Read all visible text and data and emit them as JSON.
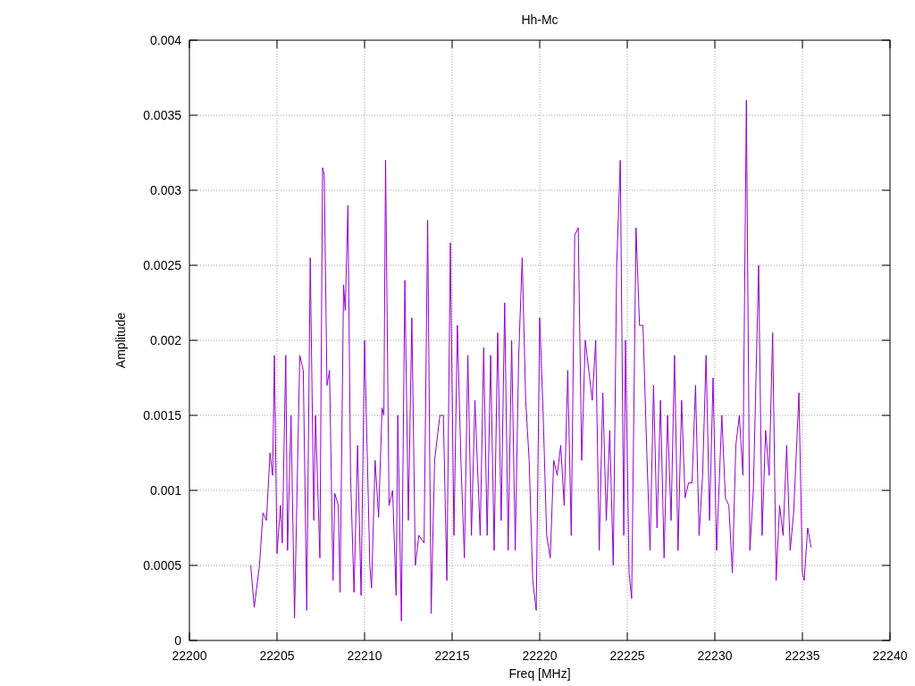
{
  "chart_data": {
    "type": "line",
    "grid": true,
    "title": "Hh-Mc",
    "xlabel": "Freq [MHz]",
    "ylabel": "Amplitude",
    "xlim": [
      22200,
      22240
    ],
    "ylim": [
      0,
      0.004
    ],
    "xticks": [
      {
        "value": 22200,
        "label": "22200"
      },
      {
        "value": 22205,
        "label": "22205"
      },
      {
        "value": 22210,
        "label": "22210"
      },
      {
        "value": 22215,
        "label": "22215"
      },
      {
        "value": 22220,
        "label": "22220"
      },
      {
        "value": 22225,
        "label": "22225"
      },
      {
        "value": 22230,
        "label": "22230"
      },
      {
        "value": 22235,
        "label": "22235"
      },
      {
        "value": 22240,
        "label": "22240"
      }
    ],
    "yticks": [
      {
        "value": 0,
        "label": "0"
      },
      {
        "value": 0.0005,
        "label": "0.0005"
      },
      {
        "value": 0.001,
        "label": "0.001"
      },
      {
        "value": 0.0015,
        "label": "0.0015"
      },
      {
        "value": 0.002,
        "label": "0.002"
      },
      {
        "value": 0.0025,
        "label": "0.0025"
      },
      {
        "value": 0.003,
        "label": "0.003"
      },
      {
        "value": 0.0035,
        "label": "0.0035"
      },
      {
        "value": 0.004,
        "label": "0.004"
      }
    ],
    "x": [
      22203.5,
      22203.7,
      22204.0,
      22204.2,
      22204.4,
      22204.6,
      22204.75,
      22204.85,
      22205.0,
      22205.2,
      22205.3,
      22205.5,
      22205.6,
      22205.8,
      22206.0,
      22206.3,
      22206.5,
      22206.7,
      22206.9,
      22207.1,
      22207.2,
      22207.45,
      22207.6,
      22207.7,
      22207.85,
      22208.0,
      22208.2,
      22208.3,
      22208.5,
      22208.6,
      22208.8,
      22208.9,
      22209.05,
      22209.2,
      22209.4,
      22209.6,
      22209.8,
      22210.0,
      22210.3,
      22210.4,
      22210.6,
      22210.8,
      22211.0,
      22211.1,
      22211.2,
      22211.4,
      22211.6,
      22211.8,
      22211.9,
      22212.1,
      22212.3,
      22212.5,
      22212.7,
      22212.9,
      22213.1,
      22213.4,
      22213.6,
      22213.8,
      22214.0,
      22214.3,
      22214.5,
      22214.7,
      22214.9,
      22215.1,
      22215.3,
      22215.5,
      22215.7,
      22215.9,
      22216.1,
      22216.3,
      22216.6,
      22216.8,
      22217.0,
      22217.2,
      22217.4,
      22217.6,
      22217.8,
      22218.0,
      22218.2,
      22218.4,
      22218.6,
      22218.8,
      22219.0,
      22219.2,
      22219.4,
      22219.6,
      22219.8,
      22220.0,
      22220.2,
      22220.4,
      22220.6,
      22220.8,
      22221.0,
      22221.2,
      22221.4,
      22221.6,
      22221.8,
      22222.0,
      22222.2,
      22222.4,
      22222.6,
      22222.8,
      22223.0,
      22223.2,
      22223.4,
      22223.6,
      22223.8,
      22224.0,
      22224.2,
      22224.4,
      22224.6,
      22224.8,
      22224.9,
      22225.1,
      22225.25,
      22225.5,
      22225.7,
      22225.9,
      22226.1,
      22226.3,
      22226.5,
      22226.7,
      22226.9,
      22227.1,
      22227.3,
      22227.5,
      22227.7,
      22227.9,
      22228.1,
      22228.3,
      22228.5,
      22228.7,
      22228.9,
      22229.1,
      22229.3,
      22229.5,
      22229.7,
      22229.9,
      22230.1,
      22230.4,
      22230.6,
      22230.8,
      22231.0,
      22231.2,
      22231.4,
      22231.6,
      22231.8,
      22232.0,
      22232.2,
      22232.5,
      22232.7,
      22232.9,
      22233.1,
      22233.3,
      22233.5,
      22233.7,
      22233.9,
      22234.1,
      22234.3,
      22234.5,
      22234.8,
      22235.0,
      22235.1,
      22235.3,
      22235.5
    ],
    "series": [
      {
        "color": "#9400d3",
        "values": [
          0.0005,
          0.00022,
          0.0005,
          0.00085,
          0.0008,
          0.00125,
          0.0011,
          0.0019,
          0.00058,
          0.0009,
          0.00065,
          0.0019,
          0.0006,
          0.0015,
          0.00015,
          0.0019,
          0.0018,
          0.0002,
          0.00255,
          0.0008,
          0.0015,
          0.00055,
          0.00315,
          0.0031,
          0.0017,
          0.0018,
          0.0004,
          0.00098,
          0.0009,
          0.00032,
          0.00237,
          0.0022,
          0.0029,
          0.0011,
          0.00032,
          0.0013,
          0.0003,
          0.002,
          0.0005,
          0.00035,
          0.0012,
          0.00082,
          0.00155,
          0.0015,
          0.0032,
          0.0009,
          0.001,
          0.0003,
          0.0015,
          0.00013,
          0.0024,
          0.0008,
          0.00215,
          0.0005,
          0.0007,
          0.00065,
          0.0028,
          0.00018,
          0.0012,
          0.0015,
          0.0015,
          0.0004,
          0.00265,
          0.0007,
          0.0021,
          0.0012,
          0.00055,
          0.0019,
          0.0007,
          0.0016,
          0.0007,
          0.00195,
          0.0007,
          0.0019,
          0.0006,
          0.00205,
          0.0008,
          0.00225,
          0.0006,
          0.002,
          0.0006,
          0.0019,
          0.00255,
          0.0016,
          0.0012,
          0.0004,
          0.0002,
          0.00215,
          0.0015,
          0.0007,
          0.00055,
          0.0012,
          0.0011,
          0.0013,
          0.0009,
          0.0018,
          0.0007,
          0.0027,
          0.00275,
          0.0012,
          0.002,
          0.0018,
          0.0016,
          0.002,
          0.0006,
          0.00165,
          0.0008,
          0.0014,
          0.0005,
          0.0025,
          0.0032,
          0.0007,
          0.002,
          0.00045,
          0.00028,
          0.00275,
          0.0021,
          0.0021,
          0.0013,
          0.0006,
          0.0017,
          0.00075,
          0.0016,
          0.00055,
          0.0015,
          0.0008,
          0.0019,
          0.0006,
          0.0016,
          0.00095,
          0.00105,
          0.00105,
          0.0017,
          0.0007,
          0.0011,
          0.0019,
          0.0008,
          0.00175,
          0.0006,
          0.0015,
          0.00095,
          0.0009,
          0.00045,
          0.0013,
          0.0015,
          0.0011,
          0.0036,
          0.0006,
          0.001,
          0.0025,
          0.0007,
          0.0014,
          0.0011,
          0.00205,
          0.0004,
          0.0009,
          0.0007,
          0.0013,
          0.0006,
          0.00085,
          0.00165,
          0.00045,
          0.0004,
          0.00075,
          0.00062
        ]
      }
    ]
  }
}
